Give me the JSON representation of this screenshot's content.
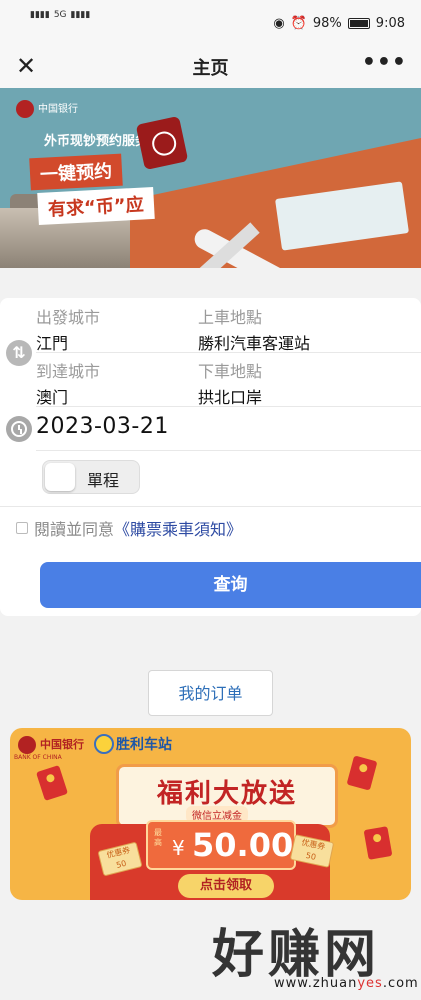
{
  "status_bar": {
    "battery": "98%",
    "time": "9:08",
    "network": "5G"
  },
  "nav": {
    "close_icon": "close-icon",
    "title": "主页",
    "more": "•••"
  },
  "banner": {
    "brand": "中国银行",
    "service": "外币现钞预约服务",
    "tagline_1": "一键预约",
    "tagline_2": "有求“币”应"
  },
  "form": {
    "departure_city_label": "出發城市",
    "departure_city": "江門",
    "pickup_point_label": "上車地點",
    "pickup_point": "勝利汽車客運站",
    "arrival_city_label": "到達城市",
    "arrival_city": "澳门",
    "dropoff_point_label": "下車地點",
    "dropoff_point": "拱北口岸",
    "date": "2023-03-21",
    "trip_type": "單程",
    "agree_text": "閱讀並同意",
    "agree_link": "《購票乘車須知》",
    "query_button": "查询"
  },
  "orders_button": "我的订单",
  "promo": {
    "brand": "中国银行",
    "brand_en": "BANK OF CHINA",
    "station": "胜利车站",
    "title": "福利大放送",
    "coupon_title": "微信立减金",
    "max_label": "最高",
    "currency": "¥",
    "amount": "50.00",
    "claim": "点击领取",
    "ticket_label": "优惠券",
    "ticket_value": "50"
  },
  "watermark": {
    "big": "好赚网",
    "site_a": "www.zhuan",
    "site_b": "yes",
    "site_c": ".com"
  },
  "colors": {
    "primary": "#4a7fe5",
    "link": "#2e4ba3",
    "promo_bg": "#f6b545",
    "promo_red": "#c22424"
  }
}
